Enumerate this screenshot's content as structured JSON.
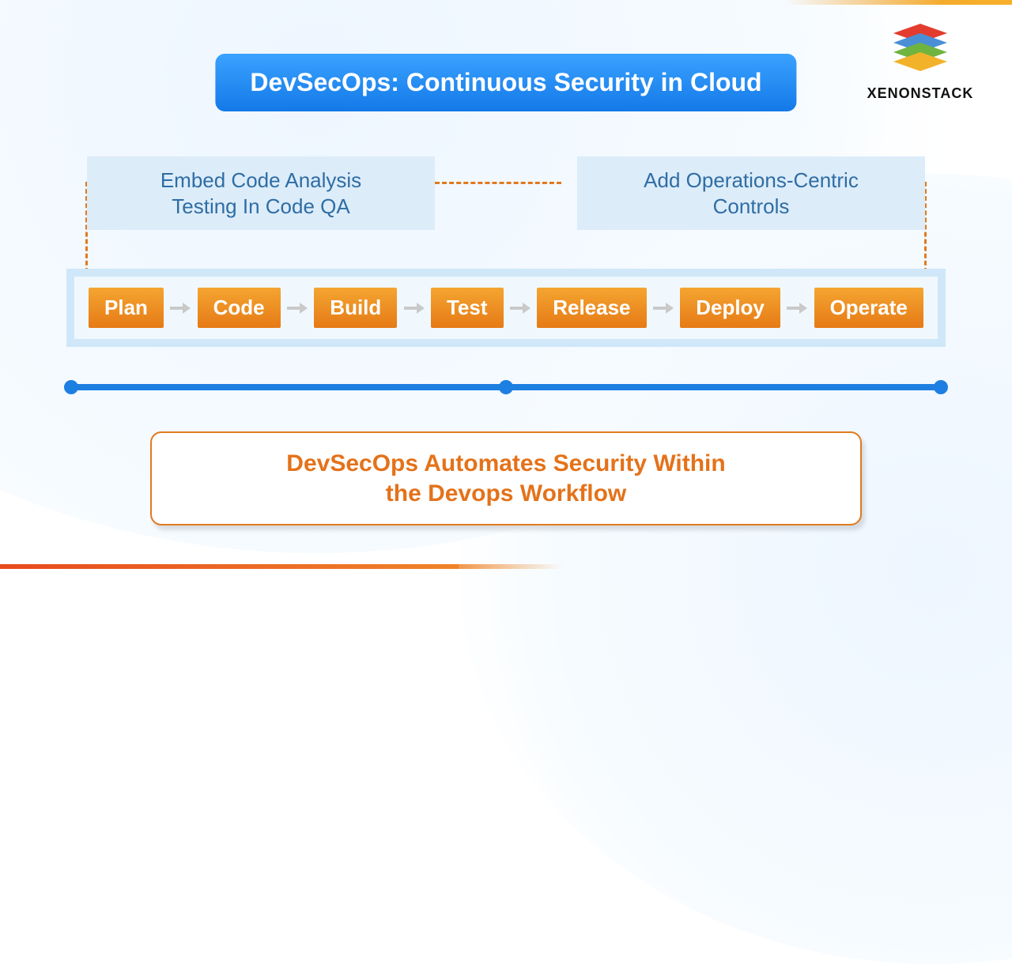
{
  "brand": {
    "name": "XENONSTACK"
  },
  "title": "DevSecOps:  Continuous Security in Cloud",
  "callouts": {
    "left_line1": "Embed Code Analysis",
    "left_line2": "Testing In Code QA",
    "right_line1": "Add Operations-Centric",
    "right_line2": "Controls"
  },
  "pipeline": {
    "stages": [
      "Plan",
      "Code",
      "Build",
      "Test",
      "Release",
      "Deploy",
      "Operate"
    ]
  },
  "statement_line1": "DevSecOps Automates Security Within",
  "statement_line2": "the Devops Workflow"
}
